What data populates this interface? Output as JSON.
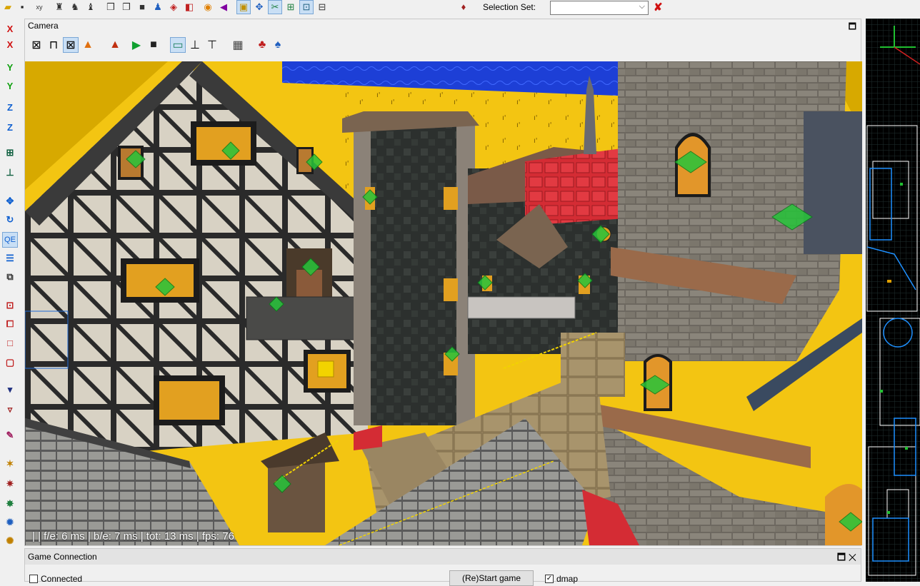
{
  "toolbar": {
    "selection_set_label": "Selection Set:",
    "selection_set_value": "",
    "icons": [
      "open-file-icon",
      "save-file-icon",
      "flip-xy-icon",
      "brush-tool-icon",
      "patch-tool-icon",
      "entity-tool-icon",
      "cube-icon",
      "cube-outline-icon",
      "cube-solid-icon",
      "camera-icon",
      "texture-icon",
      "region-icon",
      "light-icon",
      "sound-icon",
      "lock-icon",
      "snap-icon",
      "clipper-icon",
      "select-all-icon",
      "select-inside-icon",
      "portal-icon",
      "selection-clear-icon"
    ]
  },
  "left_toolbar": {
    "axis_labels": [
      "X",
      "X",
      "Y",
      "Y",
      "Z",
      "Z"
    ],
    "qe_label": "QE"
  },
  "camera": {
    "title": "Camera",
    "stats": "|  | f/e: 6 ms | b/e: 7 ms | tot: 13 ms | fps: 76"
  },
  "game_connection": {
    "title": "Game Connection",
    "connected_label": "Connected",
    "connected_checked": false,
    "restart_label": "(Re)Start game",
    "dmap_label": "dmap",
    "dmap_checked": true
  },
  "colors": {
    "accent": "#c9dff5",
    "sky_yellow": "#f3c512",
    "sky_blue": "#1d3fd6",
    "grid_blue": "#1e90ff"
  }
}
